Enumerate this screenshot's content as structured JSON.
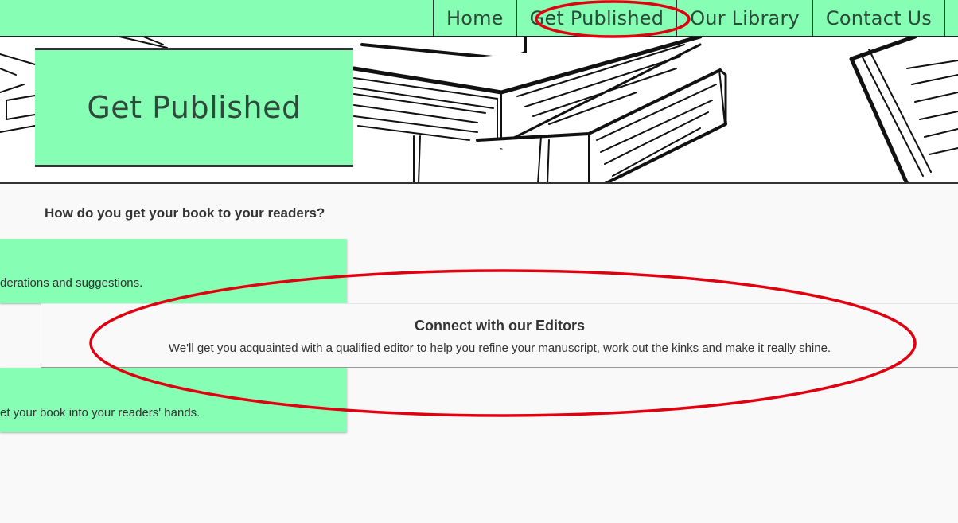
{
  "nav": {
    "items": [
      {
        "label": "Home"
      },
      {
        "label": "Get Published"
      },
      {
        "label": "Our Library"
      },
      {
        "label": "Contact Us"
      }
    ]
  },
  "hero": {
    "title": "Get Published"
  },
  "content": {
    "question": "How do you get your book to your readers?",
    "cards": [
      {
        "text": "derations and suggestions."
      },
      {
        "title": "Connect with our Editors",
        "text": "We'll get you acquainted with a qualified editor to help you refine your manuscript, work out the kinks and make it really shine."
      },
      {
        "text": "et your book into your readers' hands."
      }
    ]
  },
  "colors": {
    "accent_green": "#86ffb4",
    "annotation_red": "#e0000f"
  }
}
